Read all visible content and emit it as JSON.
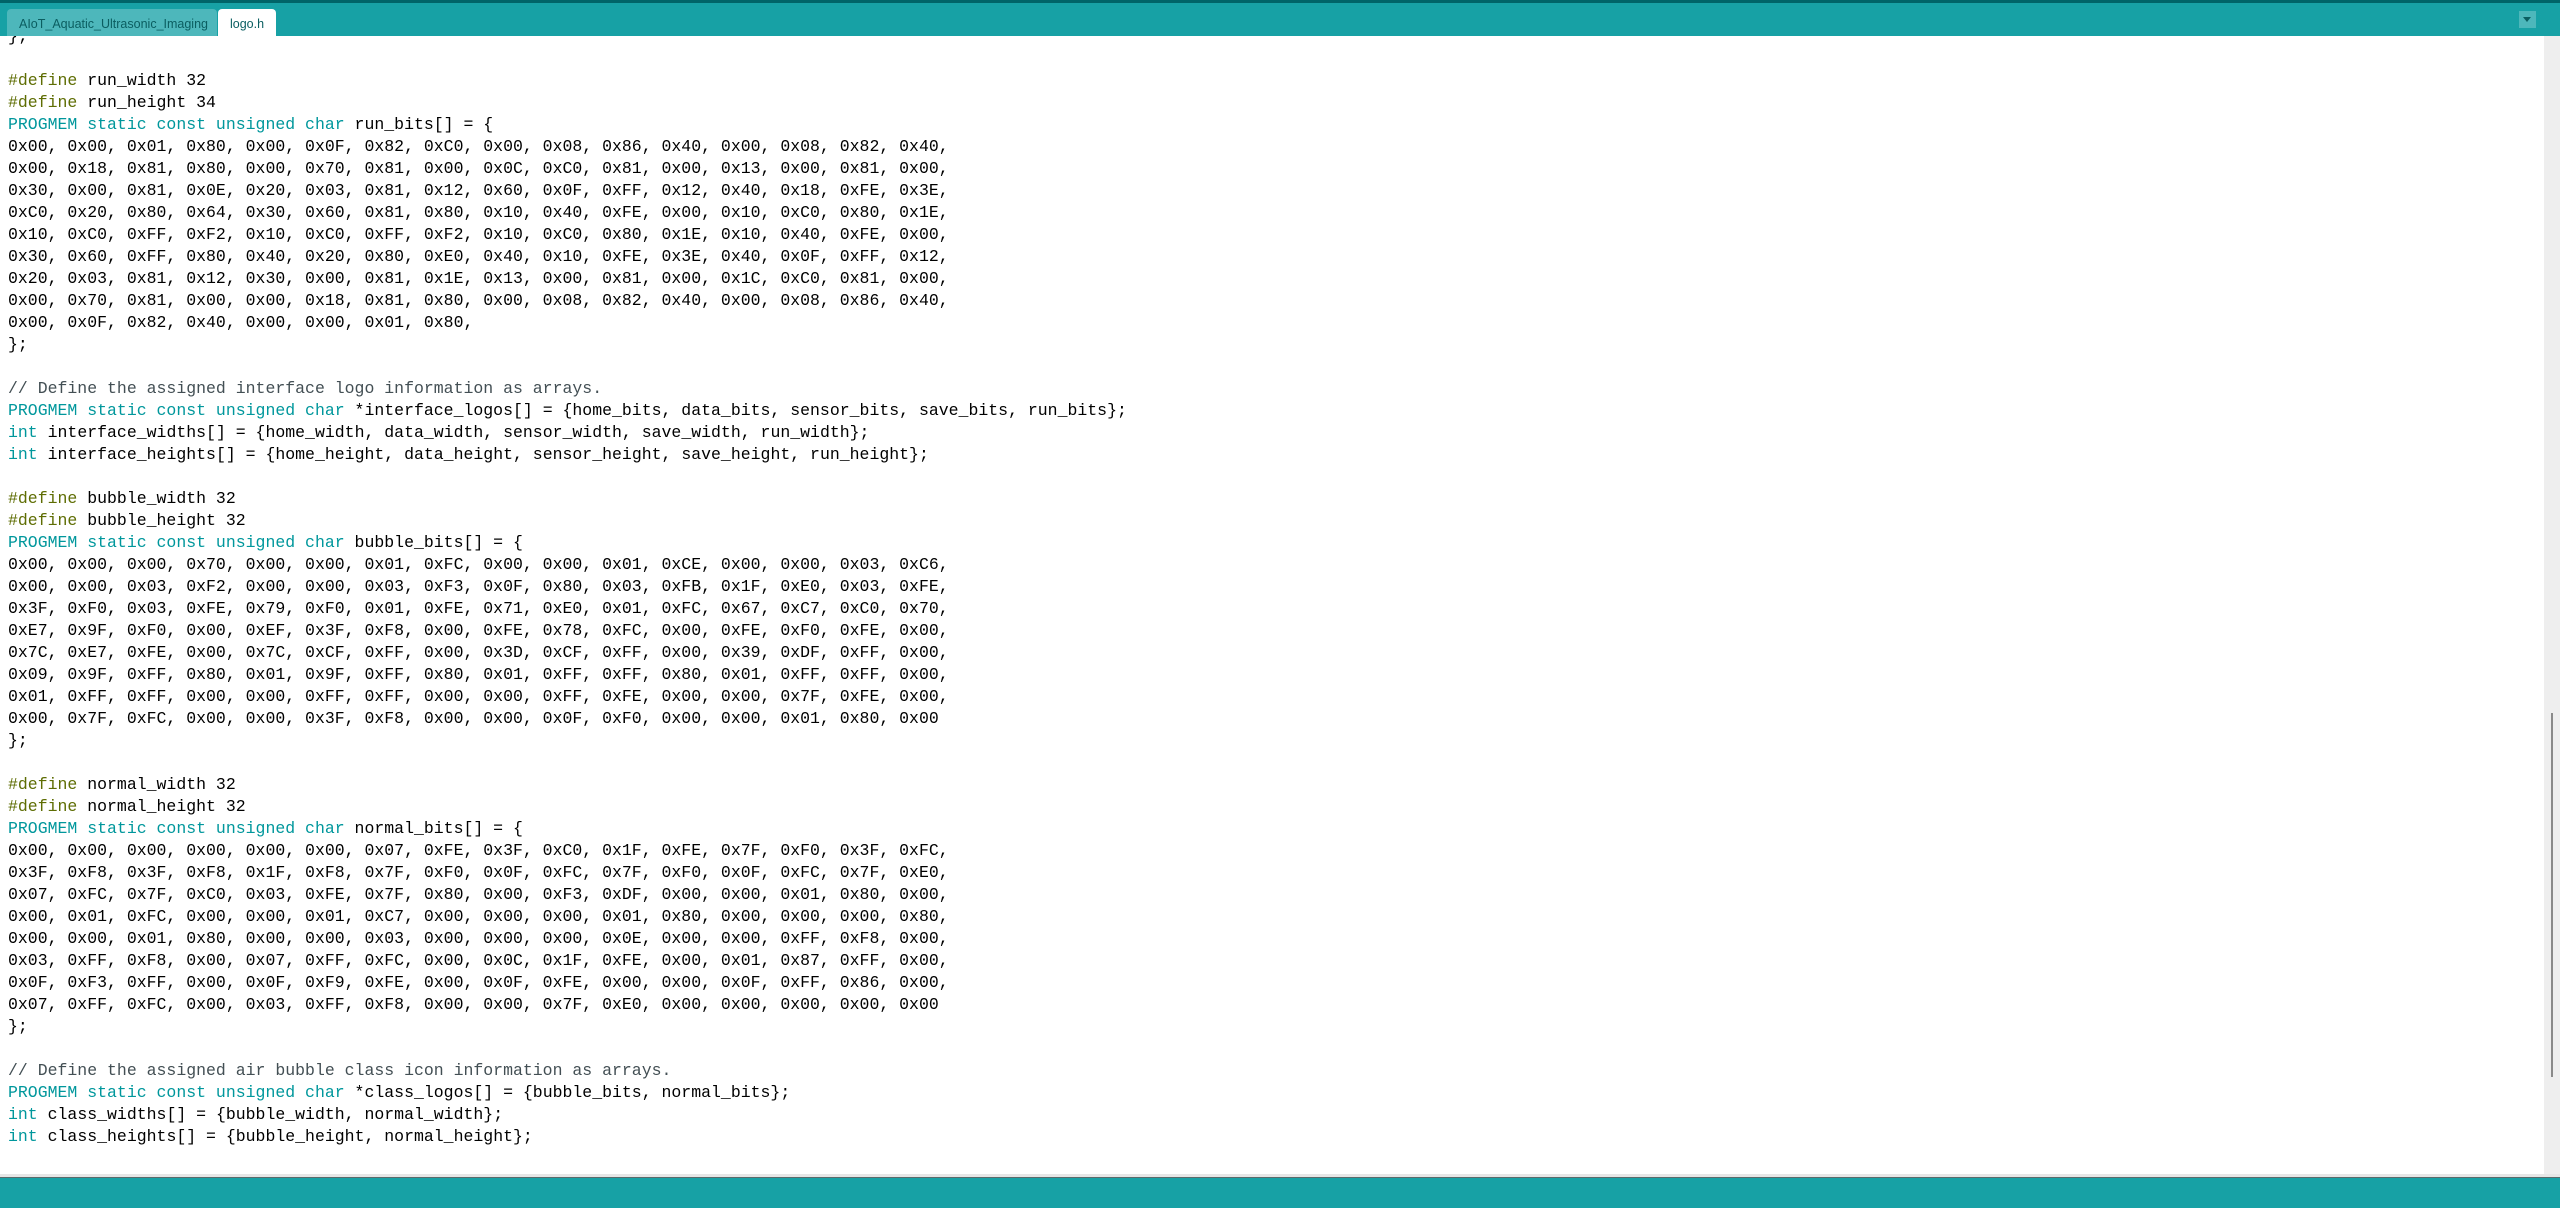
{
  "tabs": [
    {
      "label": "AIoT_Aquatic_Ultrasonic_Imaging",
      "active": false
    },
    {
      "label": "logo.h",
      "active": true
    }
  ],
  "tab_menu_icon": "chevron-down-icon",
  "colors": {
    "header": "#17a1a5",
    "keyword": "#00979c",
    "preprocessor": "#5e6d03",
    "comment": "#434f54"
  },
  "code_lines": [
    [
      {
        "t": "};"
      }
    ],
    [],
    [
      {
        "t": "#define",
        "c": "pp"
      },
      {
        "t": " run_width 32"
      }
    ],
    [
      {
        "t": "#define",
        "c": "pp"
      },
      {
        "t": " run_height 34"
      }
    ],
    [
      {
        "t": "PROGMEM static const unsigned char",
        "c": "kw"
      },
      {
        "t": " run_bits[] = {"
      }
    ],
    [
      {
        "t": "0x00, 0x00, 0x01, 0x80, 0x00, 0x0F, 0x82, 0xC0, 0x00, 0x08, 0x86, 0x40, 0x00, 0x08, 0x82, 0x40,"
      }
    ],
    [
      {
        "t": "0x00, 0x18, 0x81, 0x80, 0x00, 0x70, 0x81, 0x00, 0x0C, 0xC0, 0x81, 0x00, 0x13, 0x00, 0x81, 0x00,"
      }
    ],
    [
      {
        "t": "0x30, 0x00, 0x81, 0x0E, 0x20, 0x03, 0x81, 0x12, 0x60, 0x0F, 0xFF, 0x12, 0x40, 0x18, 0xFE, 0x3E,"
      }
    ],
    [
      {
        "t": "0xC0, 0x20, 0x80, 0x64, 0x30, 0x60, 0x81, 0x80, 0x10, 0x40, 0xFE, 0x00, 0x10, 0xC0, 0x80, 0x1E,"
      }
    ],
    [
      {
        "t": "0x10, 0xC0, 0xFF, 0xF2, 0x10, 0xC0, 0xFF, 0xF2, 0x10, 0xC0, 0x80, 0x1E, 0x10, 0x40, 0xFE, 0x00,"
      }
    ],
    [
      {
        "t": "0x30, 0x60, 0xFF, 0x80, 0x40, 0x20, 0x80, 0xE0, 0x40, 0x10, 0xFE, 0x3E, 0x40, 0x0F, 0xFF, 0x12,"
      }
    ],
    [
      {
        "t": "0x20, 0x03, 0x81, 0x12, 0x30, 0x00, 0x81, 0x1E, 0x13, 0x00, 0x81, 0x00, 0x1C, 0xC0, 0x81, 0x00,"
      }
    ],
    [
      {
        "t": "0x00, 0x70, 0x81, 0x00, 0x00, 0x18, 0x81, 0x80, 0x00, 0x08, 0x82, 0x40, 0x00, 0x08, 0x86, 0x40,"
      }
    ],
    [
      {
        "t": "0x00, 0x0F, 0x82, 0x40, 0x00, 0x00, 0x01, 0x80,"
      }
    ],
    [
      {
        "t": "};"
      }
    ],
    [],
    [
      {
        "t": "// Define the assigned interface logo information as arrays.",
        "c": "cm"
      }
    ],
    [
      {
        "t": "PROGMEM static const unsigned char",
        "c": "kw"
      },
      {
        "t": " *interface_logos[] = {home_bits, data_bits, sensor_bits, save_bits, run_bits};"
      }
    ],
    [
      {
        "t": "int",
        "c": "kw"
      },
      {
        "t": " interface_widths[] = {home_width, data_width, sensor_width, save_width, run_width};"
      }
    ],
    [
      {
        "t": "int",
        "c": "kw"
      },
      {
        "t": " interface_heights[] = {home_height, data_height, sensor_height, save_height, run_height};"
      }
    ],
    [],
    [
      {
        "t": "#define",
        "c": "pp"
      },
      {
        "t": " bubble_width 32"
      }
    ],
    [
      {
        "t": "#define",
        "c": "pp"
      },
      {
        "t": " bubble_height 32"
      }
    ],
    [
      {
        "t": "PROGMEM static const unsigned char",
        "c": "kw"
      },
      {
        "t": " bubble_bits[] = {"
      }
    ],
    [
      {
        "t": "0x00, 0x00, 0x00, 0x70, 0x00, 0x00, 0x01, 0xFC, 0x00, 0x00, 0x01, 0xCE, 0x00, 0x00, 0x03, 0xC6,"
      }
    ],
    [
      {
        "t": "0x00, 0x00, 0x03, 0xF2, 0x00, 0x00, 0x03, 0xF3, 0x0F, 0x80, 0x03, 0xFB, 0x1F, 0xE0, 0x03, 0xFE,"
      }
    ],
    [
      {
        "t": "0x3F, 0xF0, 0x03, 0xFE, 0x79, 0xF0, 0x01, 0xFE, 0x71, 0xE0, 0x01, 0xFC, 0x67, 0xC7, 0xC0, 0x70,"
      }
    ],
    [
      {
        "t": "0xE7, 0x9F, 0xF0, 0x00, 0xEF, 0x3F, 0xF8, 0x00, 0xFE, 0x78, 0xFC, 0x00, 0xFE, 0xF0, 0xFE, 0x00,"
      }
    ],
    [
      {
        "t": "0x7C, 0xE7, 0xFE, 0x00, 0x7C, 0xCF, 0xFF, 0x00, 0x3D, 0xCF, 0xFF, 0x00, 0x39, 0xDF, 0xFF, 0x00,"
      }
    ],
    [
      {
        "t": "0x09, 0x9F, 0xFF, 0x80, 0x01, 0x9F, 0xFF, 0x80, 0x01, 0xFF, 0xFF, 0x80, 0x01, 0xFF, 0xFF, 0x00,"
      }
    ],
    [
      {
        "t": "0x01, 0xFF, 0xFF, 0x00, 0x00, 0xFF, 0xFF, 0x00, 0x00, 0xFF, 0xFE, 0x00, 0x00, 0x7F, 0xFE, 0x00,"
      }
    ],
    [
      {
        "t": "0x00, 0x7F, 0xFC, 0x00, 0x00, 0x3F, 0xF8, 0x00, 0x00, 0x0F, 0xF0, 0x00, 0x00, 0x01, 0x80, 0x00"
      }
    ],
    [
      {
        "t": "};"
      }
    ],
    [],
    [
      {
        "t": "#define",
        "c": "pp"
      },
      {
        "t": " normal_width 32"
      }
    ],
    [
      {
        "t": "#define",
        "c": "pp"
      },
      {
        "t": " normal_height 32"
      }
    ],
    [
      {
        "t": "PROGMEM static const unsigned char",
        "c": "kw"
      },
      {
        "t": " normal_bits[] = {"
      }
    ],
    [
      {
        "t": "0x00, 0x00, 0x00, 0x00, 0x00, 0x00, 0x07, 0xFE, 0x3F, 0xC0, 0x1F, 0xFE, 0x7F, 0xF0, 0x3F, 0xFC,"
      }
    ],
    [
      {
        "t": "0x3F, 0xF8, 0x3F, 0xF8, 0x1F, 0xF8, 0x7F, 0xF0, 0x0F, 0xFC, 0x7F, 0xF0, 0x0F, 0xFC, 0x7F, 0xE0,"
      }
    ],
    [
      {
        "t": "0x07, 0xFC, 0x7F, 0xC0, 0x03, 0xFE, 0x7F, 0x80, 0x00, 0xF3, 0xDF, 0x00, 0x00, 0x01, 0x80, 0x00,"
      }
    ],
    [
      {
        "t": "0x00, 0x01, 0xFC, 0x00, 0x00, 0x01, 0xC7, 0x00, 0x00, 0x00, 0x01, 0x80, 0x00, 0x00, 0x00, 0x80,"
      }
    ],
    [
      {
        "t": "0x00, 0x00, 0x01, 0x80, 0x00, 0x00, 0x03, 0x00, 0x00, 0x00, 0x0E, 0x00, 0x00, 0xFF, 0xF8, 0x00,"
      }
    ],
    [
      {
        "t": "0x03, 0xFF, 0xF8, 0x00, 0x07, 0xFF, 0xFC, 0x00, 0x0C, 0x1F, 0xFE, 0x00, 0x01, 0x87, 0xFF, 0x00,"
      }
    ],
    [
      {
        "t": "0x0F, 0xF3, 0xFF, 0x00, 0x0F, 0xF9, 0xFE, 0x00, 0x0F, 0xFE, 0x00, 0x00, 0x0F, 0xFF, 0x86, 0x00,"
      }
    ],
    [
      {
        "t": "0x07, 0xFF, 0xFC, 0x00, 0x03, 0xFF, 0xF8, 0x00, 0x00, 0x7F, 0xE0, 0x00, 0x00, 0x00, 0x00, 0x00"
      }
    ],
    [
      {
        "t": "};"
      }
    ],
    [],
    [
      {
        "t": "// Define the assigned air bubble class icon information as arrays.",
        "c": "cm"
      }
    ],
    [
      {
        "t": "PROGMEM static const unsigned char",
        "c": "kw"
      },
      {
        "t": " *class_logos[] = {bubble_bits, normal_bits};"
      }
    ],
    [
      {
        "t": "int",
        "c": "kw"
      },
      {
        "t": " class_widths[] = {bubble_width, normal_width};"
      }
    ],
    [
      {
        "t": "int",
        "c": "kw"
      },
      {
        "t": " class_heights[] = {bubble_height, normal_height};"
      }
    ]
  ]
}
